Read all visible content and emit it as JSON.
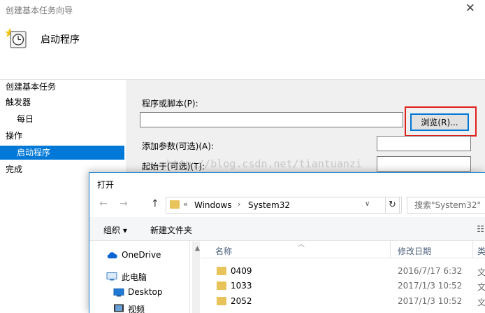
{
  "wizard": {
    "window_title": "创建基本任务向导",
    "close_glyph": "✕",
    "heading": "启动程序",
    "nav": [
      {
        "label": "创建基本任务"
      },
      {
        "label": "触发器"
      },
      {
        "label": "每日"
      },
      {
        "label": "操作"
      },
      {
        "label": "启动程序"
      },
      {
        "label": "完成"
      }
    ],
    "program_label": "程序或脚本(P):",
    "program_value": "",
    "browse_label": "浏览(R)...",
    "args_label": "添加参数(可选)(A):",
    "args_value": "",
    "startin_label": "起始于(可选)(T):",
    "startin_value": "",
    "watermark": "http://blog.csdn.net/tiantuanzi",
    "highlight_color": "#e0201b"
  },
  "dialog": {
    "title": "打开",
    "back_glyph": "←",
    "forward_glyph": "→",
    "up_glyph": "↑",
    "breadcrumb_prefix": "«",
    "breadcrumb": [
      "Windows",
      "System32"
    ],
    "breadcrumb_sep": "›",
    "dropdown_glyph": "∨",
    "refresh_glyph": "↻",
    "search_placeholder": "搜索\"System32\"",
    "toolbar": {
      "organize": "组织 ▾",
      "new_folder": "新建文件夹",
      "view_glyph": "☷"
    },
    "tree": [
      {
        "label": "OneDrive",
        "icon": "cloud-icon"
      },
      {
        "label": "此电脑",
        "icon": "computer-icon"
      },
      {
        "label": "Desktop",
        "icon": "desktop-icon"
      },
      {
        "label": "视频",
        "icon": "video-icon"
      }
    ],
    "columns": {
      "name": "名称",
      "date": "修改日期",
      "type": "类"
    },
    "rows": [
      {
        "name": "0409",
        "date": "2016/7/17 6:32",
        "type": "文"
      },
      {
        "name": "1033",
        "date": "2017/1/3 10:52",
        "type": "文"
      },
      {
        "name": "2052",
        "date": "2017/1/3 10:52",
        "type": "文"
      }
    ],
    "accent_color": "#0078d7",
    "folder_color": "#e8c35a"
  }
}
